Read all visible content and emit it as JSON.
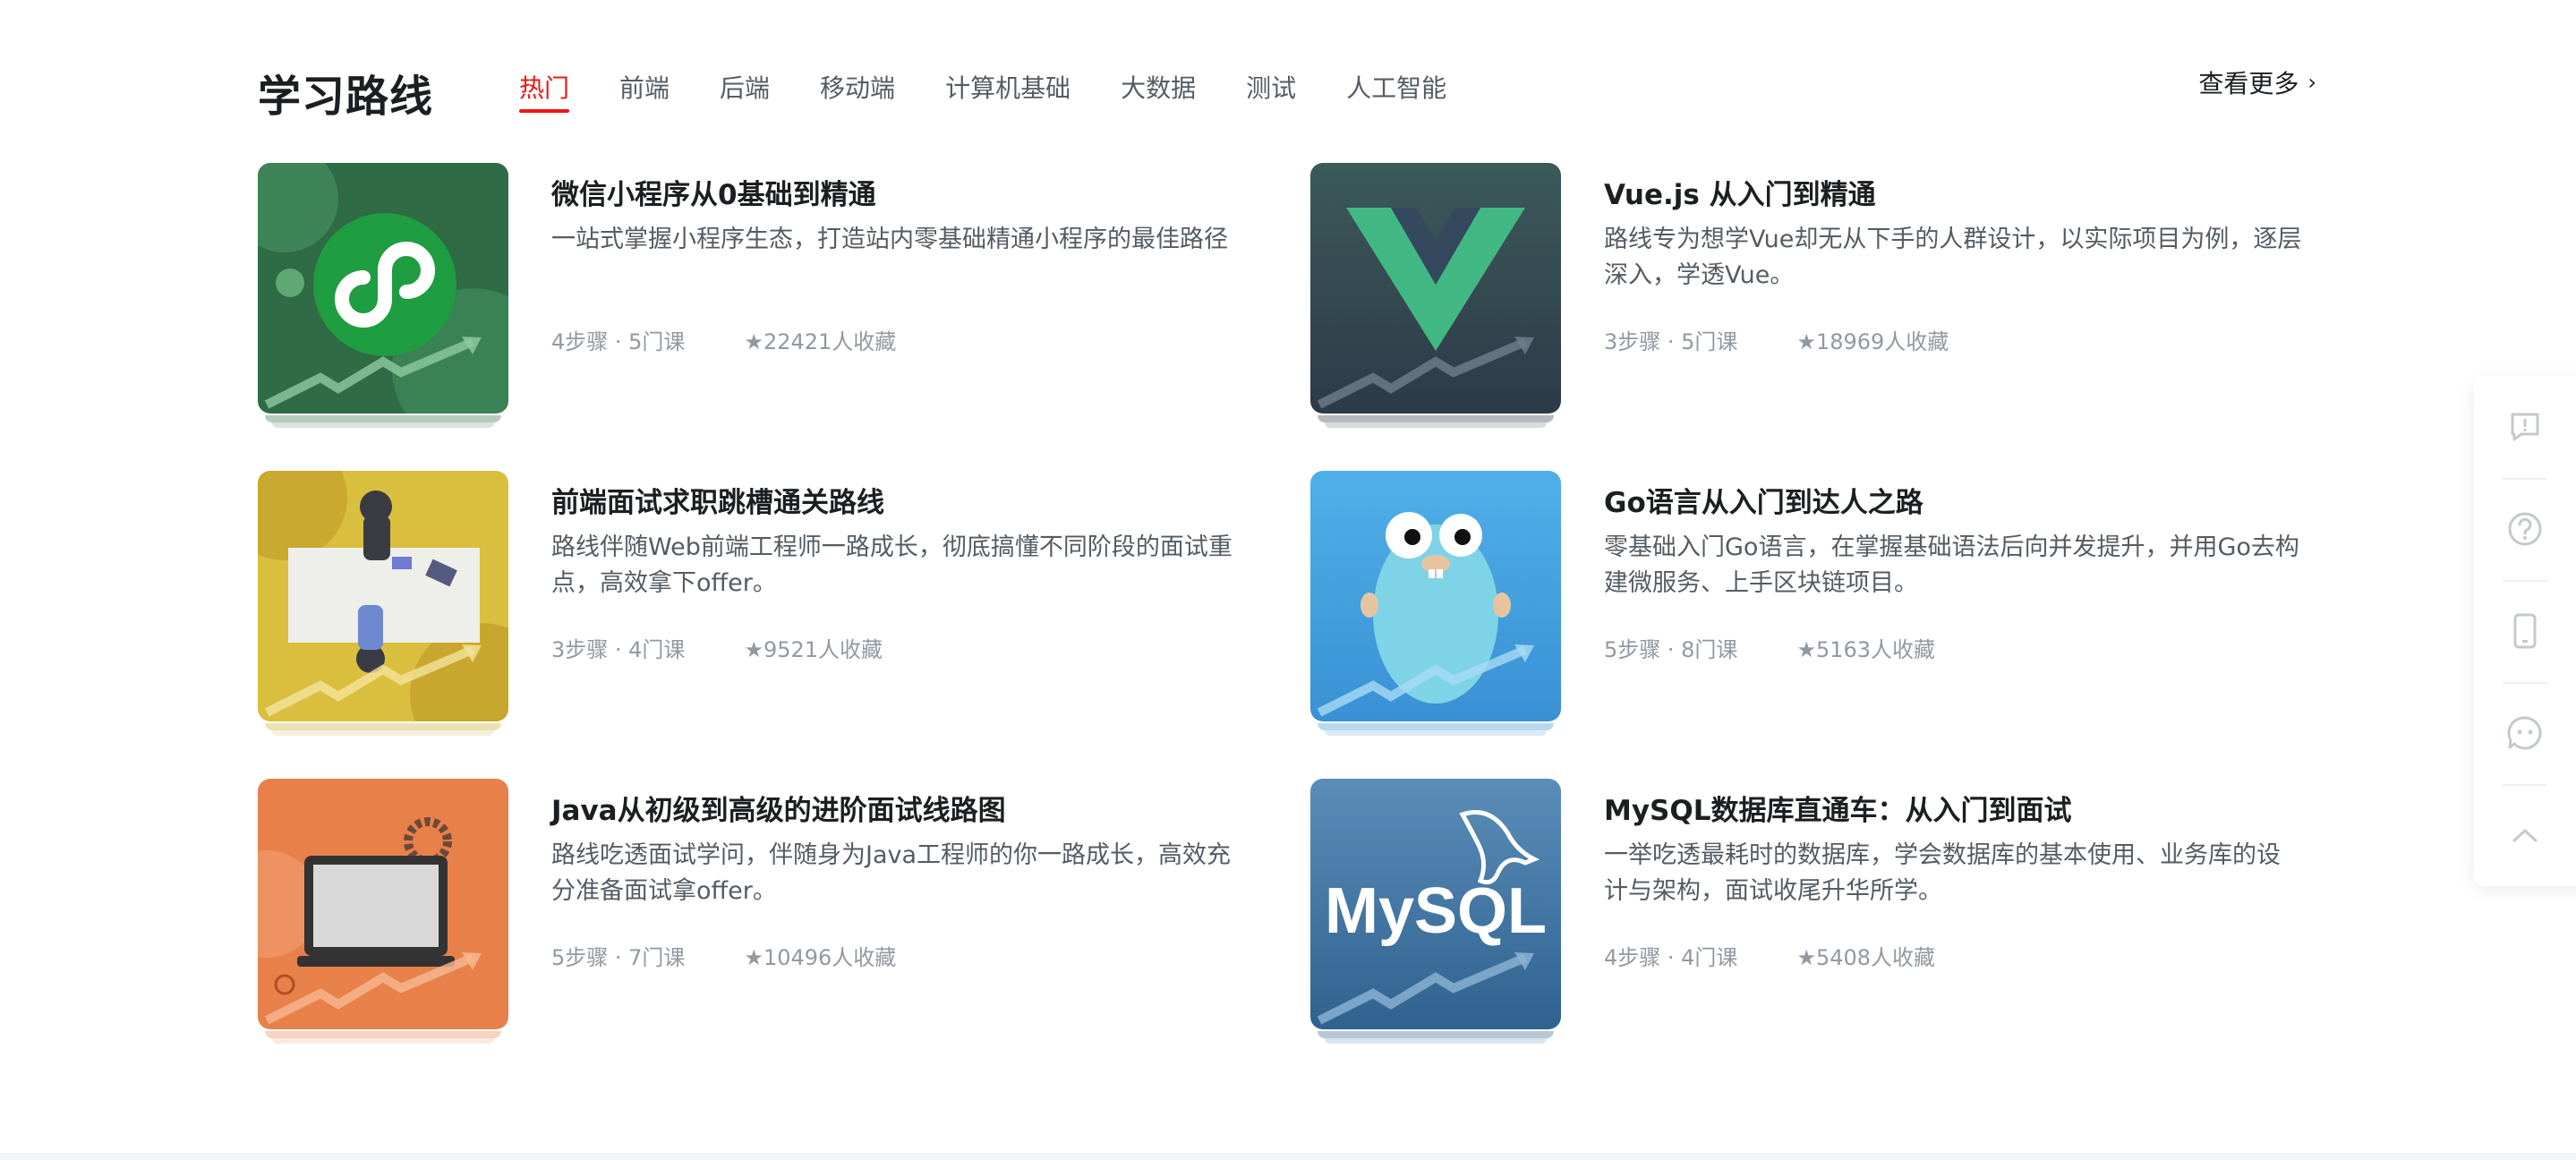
{
  "header": {
    "title": "学习路线",
    "tabs": [
      "热门",
      "前端",
      "后端",
      "移动端",
      "计算机基础",
      "大数据",
      "测试",
      "人工智能"
    ],
    "active_tab": "热门",
    "more_label": "查看更多"
  },
  "cards": [
    {
      "title": "微信小程序从0基础到精通",
      "desc": "一站式掌握小程序生态，打造站内零基础精通小程序的最佳路径",
      "steps": "4步骤 · 5门课",
      "favorites": "★22421人收藏",
      "thumb": "wechat-miniprogram"
    },
    {
      "title": "Vue.js 从入门到精通",
      "desc": "路线专为想学Vue却无从下手的人群设计，以实际项目为例，逐层深入，学透Vue。",
      "steps": "3步骤 · 5门课",
      "favorites": "★18969人收藏",
      "thumb": "vue"
    },
    {
      "title": "前端面试求职跳槽通关路线",
      "desc": "路线伴随Web前端工程师一路成长，彻底搞懂不同阶段的面试重点，高效拿下offer。",
      "steps": "3步骤 · 4门课",
      "favorites": "★9521人收藏",
      "thumb": "interview"
    },
    {
      "title": "Go语言从入门到达人之路",
      "desc": "零基础入门Go语言，在掌握基础语法后向并发提升，并用Go去构建微服务、上手区块链项目。",
      "steps": "5步骤 · 8门课",
      "favorites": "★5163人收藏",
      "thumb": "gopher"
    },
    {
      "title": "Java从初级到高级的进阶面试线路图",
      "desc": "路线吃透面试学问，伴随身为Java工程师的你一路成长，高效充分准备面试拿offer。",
      "steps": "5步骤 · 7门课",
      "favorites": "★10496人收藏",
      "thumb": "laptop"
    },
    {
      "title": "MySQL数据库直通车：从入门到面试",
      "desc": "一举吃透最耗时的数据库，学会数据库的基本使用、业务库的设计与架构，面试收尾升华所学。",
      "steps": "4步骤 · 4门课",
      "favorites": "★5408人收藏",
      "thumb": "mysql",
      "thumb_text": "MySQL"
    }
  ],
  "sidebar": {
    "items": [
      "feedback-icon",
      "help-icon",
      "phone-icon",
      "chat-icon",
      "back-to-top-icon"
    ]
  },
  "colors": {
    "accent": "#f01414",
    "title": "#1c1f21",
    "desc": "#545c63",
    "meta": "#9199a1"
  }
}
